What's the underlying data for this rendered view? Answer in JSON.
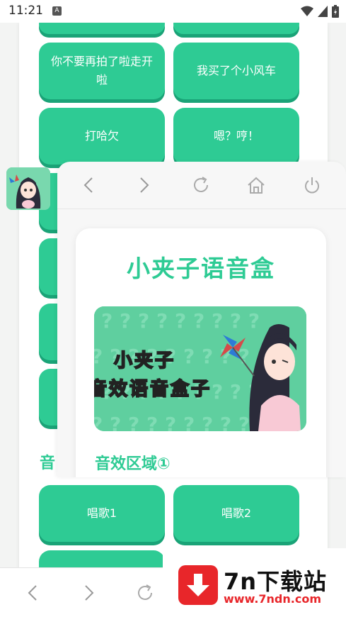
{
  "status_bar": {
    "time": "11:21",
    "notification_icon": "A"
  },
  "background_page": {
    "buttons": [
      {
        "label": ""
      },
      {
        "label": ""
      },
      {
        "label": "你不要再拍了啦走开啦"
      },
      {
        "label": "我买了个小风车"
      },
      {
        "label": "打哈欠"
      },
      {
        "label": "嗯？哼！"
      },
      {
        "label": ""
      },
      {
        "label": ""
      },
      {
        "label": ""
      },
      {
        "label": ""
      },
      {
        "label": "唱歌1"
      },
      {
        "label": "唱歌2"
      },
      {
        "label": ""
      }
    ],
    "section_title": "音"
  },
  "floating_window": {
    "title": "小夹子语音盒",
    "banner_line1": "小夹子",
    "banner_line2": "音效语音盒子",
    "section_title": "音效区域①"
  },
  "watermark": {
    "title": "7n下载站",
    "url": "www.7ndn.com"
  },
  "colors": {
    "accent": "#2ecb94",
    "accent_shadow": "#1aa377",
    "watermark_red": "#e8262a"
  }
}
